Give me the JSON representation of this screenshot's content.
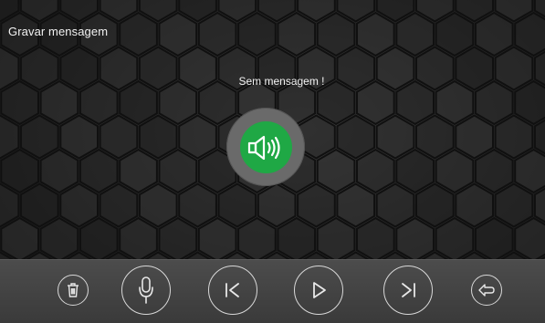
{
  "screen": {
    "title": "Gravar mensagem",
    "status_message": "Sem mensagem !"
  },
  "speaker": {
    "icon": "speaker-volume-icon",
    "color": "#1fa845"
  },
  "toolbar": {
    "buttons": [
      {
        "icon": "trash-icon"
      },
      {
        "icon": "microphone-icon"
      },
      {
        "icon": "previous-icon"
      },
      {
        "icon": "play-icon"
      },
      {
        "icon": "next-icon"
      },
      {
        "icon": "back-icon"
      }
    ]
  }
}
